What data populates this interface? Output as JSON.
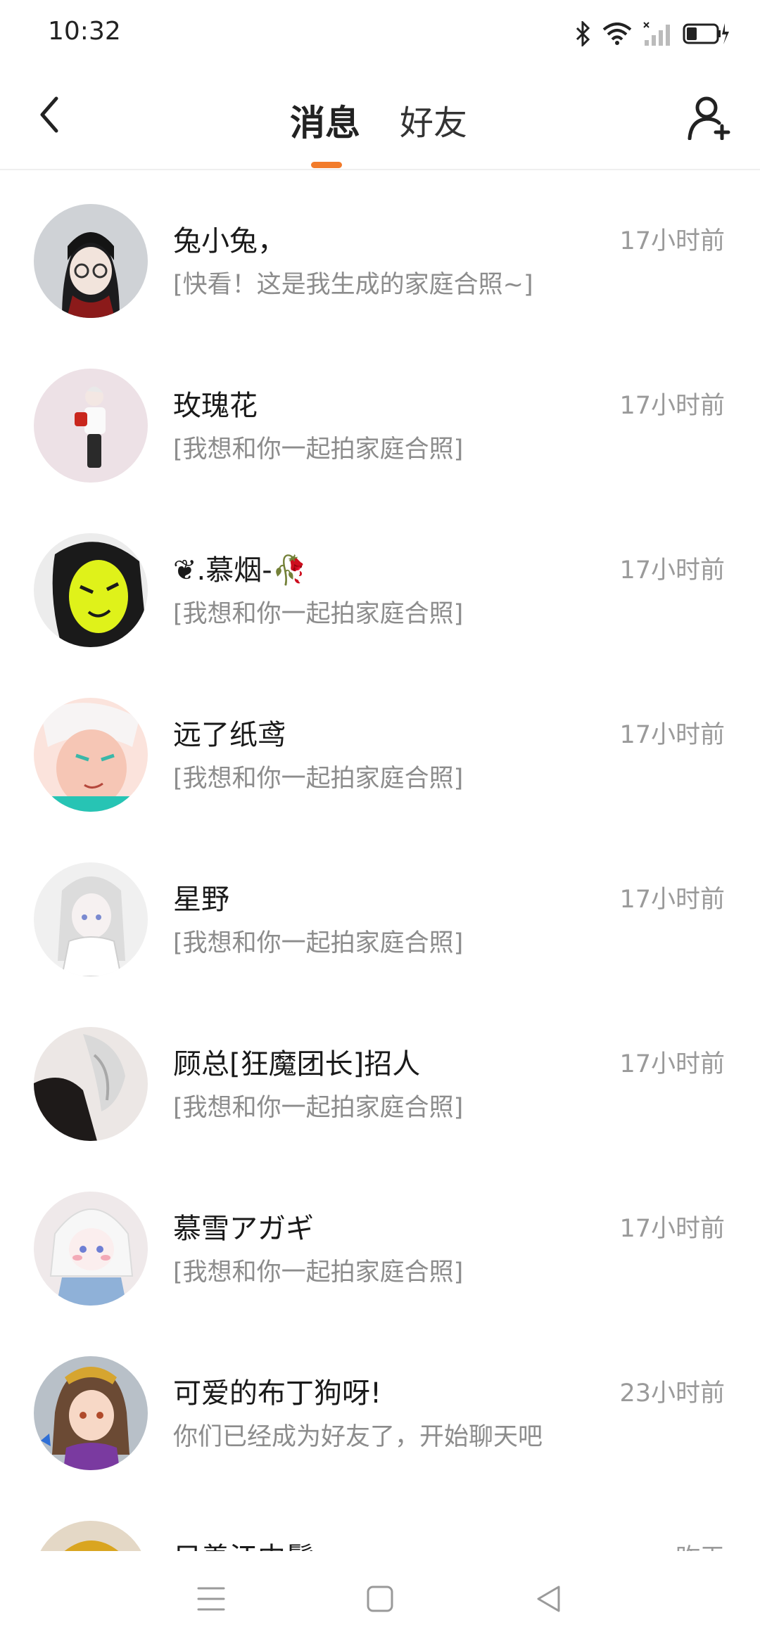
{
  "status_bar": {
    "time": "10:32",
    "icons": [
      "bluetooth-icon",
      "wifi-icon",
      "signal-icon",
      "battery-icon"
    ]
  },
  "header": {
    "tabs": [
      {
        "label": "消息",
        "active": true
      },
      {
        "label": "好友",
        "active": false
      }
    ],
    "accent_color": "#f27b2a",
    "icons": [
      "back-arrow-icon",
      "add-friend-icon"
    ]
  },
  "conversations": [
    {
      "name": "兔小兔，",
      "preview": "[快看！这是我生成的家庭合照~]",
      "time": "17小时前"
    },
    {
      "name": "玫瑰花",
      "preview": "[我想和你一起拍家庭合照]",
      "time": "17小时前"
    },
    {
      "name": "❦.慕烟-🥀",
      "preview": "[我想和你一起拍家庭合照]",
      "time": "17小时前"
    },
    {
      "name": "远了纸鸢",
      "preview": "[我想和你一起拍家庭合照]",
      "time": "17小时前"
    },
    {
      "name": "星野",
      "preview": "[我想和你一起拍家庭合照]",
      "time": "17小时前"
    },
    {
      "name": "顾总[狂魔团长]招人",
      "preview": "[我想和你一起拍家庭合照]",
      "time": "17小时前"
    },
    {
      "name": "慕雪アガギ",
      "preview": "[我想和你一起拍家庭合照]",
      "time": "17小时前"
    },
    {
      "name": "可爱的布丁狗呀!",
      "preview": "你们已经成为好友了，开始聊天吧",
      "time": "23小时前"
    },
    {
      "name": "只善江中鬓",
      "preview": "",
      "time": "昨天"
    }
  ],
  "nav_bar": {
    "icons": [
      "menu-icon",
      "home-icon",
      "back-icon"
    ]
  }
}
